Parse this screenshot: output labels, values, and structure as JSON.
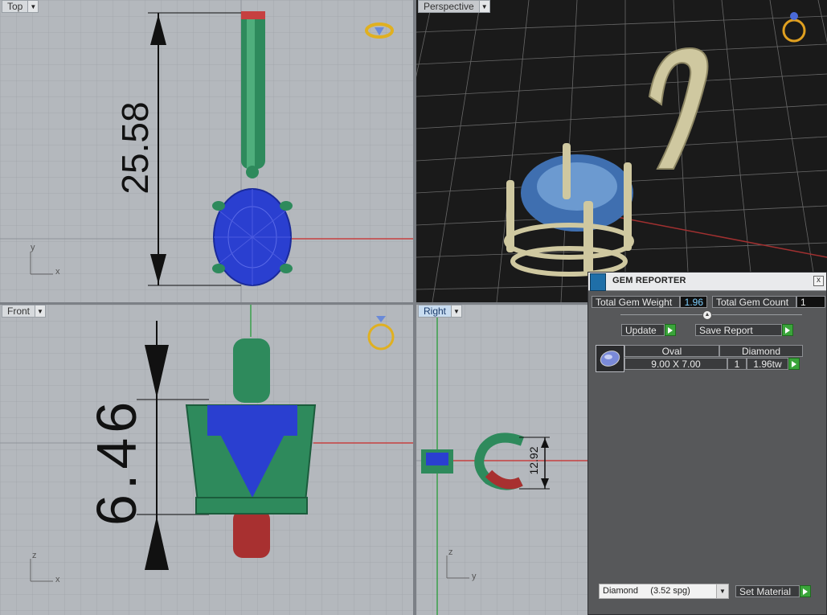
{
  "viewports": {
    "top": {
      "label": "Top",
      "dimension": "25.58"
    },
    "perspective": {
      "label": "Perspective"
    },
    "front": {
      "label": "Front",
      "dimension": "6.46"
    },
    "right": {
      "label": "Right",
      "dimension": "12.92"
    }
  },
  "axis": {
    "x": "x",
    "y": "y",
    "z": "z"
  },
  "gem_reporter": {
    "title": "GEM REPORTER",
    "close": "x",
    "total_weight_label": "Total Gem Weight",
    "total_weight_value": "1.96",
    "total_count_label": "Total Gem Count",
    "total_count_value": "1",
    "update_label": "Update",
    "save_report_label": "Save Report",
    "table": {
      "shape": "Oval",
      "material": "Diamond",
      "size": "9.00 X 7.00",
      "count": "1",
      "weight": "1.96tw"
    },
    "material_select": "Diamond     (3.52 spg)",
    "set_material_label": "Set Material"
  },
  "colors": {
    "grid_bg": "#b4b8bd",
    "persp_bg": "#1a1a1a",
    "metal_green": "#2e8a5c",
    "gem_blue": "#2a3fd0",
    "gold": "#e0b020",
    "axis_red": "#c64040",
    "axis_green": "#3aa04a"
  }
}
